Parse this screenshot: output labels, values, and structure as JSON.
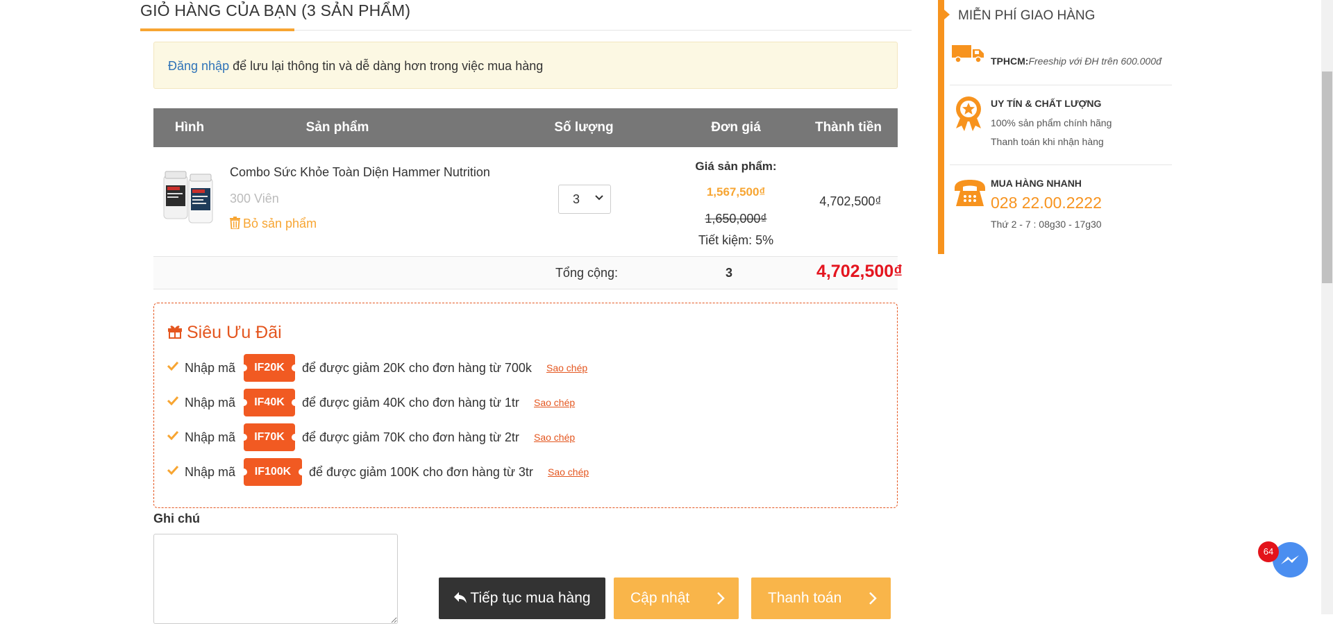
{
  "cart": {
    "title": "GIỎ HÀNG CỦA BẠN (3 SẢN PHẨM)",
    "notice_link": "Đăng nhập",
    "notice_text": " để lưu lại thông tin và dễ dàng hơn trong việc mua hàng",
    "columns": [
      "Hình",
      "Sản phẩm",
      "Số lượng",
      "Đơn giá",
      "Thành tiền"
    ],
    "item": {
      "name": "Combo Sức Khỏe Toàn Diện Hammer Nutrition",
      "variant": "300 Viên",
      "remove_label": "Bỏ sản phẩm",
      "quantity": "3",
      "price_label": "Giá sản phẩm:",
      "sale_price": "1,567,500₫",
      "old_price": "1,650,000₫",
      "saving": "Tiết kiệm: 5%",
      "line_total": "4,702,500₫"
    },
    "summary": {
      "label": "Tổng cộng:",
      "quantity": "3",
      "total": "4,702,500₫"
    }
  },
  "promo": {
    "title": "Siêu Ưu Đãi",
    "items": [
      {
        "prefix": "Nhập mã",
        "code": "IF20K",
        "desc": "để được giảm 20K cho đơn hàng từ 700k",
        "copy": "Sao chép"
      },
      {
        "prefix": "Nhập mã",
        "code": "IF40K",
        "desc": "để được giảm 40K cho đơn hàng từ 1tr",
        "copy": "Sao chép"
      },
      {
        "prefix": "Nhập mã",
        "code": "IF70K",
        "desc": "để được giảm 70K cho đơn hàng từ 2tr",
        "copy": "Sao chép"
      },
      {
        "prefix": "Nhập mã",
        "code": "IF100K",
        "desc": "để được giảm 100K cho đơn hàng từ 3tr",
        "copy": "Sao chép"
      }
    ]
  },
  "note": {
    "label": "Ghi chú",
    "value": ""
  },
  "buttons": {
    "continue": "Tiếp tục mua hàng",
    "update": "Cập nhật",
    "checkout": "Thanh toán"
  },
  "sidebar": {
    "heading": "MIỄN PHÍ GIAO HÀNG",
    "shipping_bold": "TPHCM:",
    "shipping_text": "Freeship với ĐH trên 600.000đ",
    "quality_title": "UY TÍN & CHẤT LƯỢNG",
    "quality_line1": "100% sản phẩm chính hãng",
    "quality_line2": "Thanh toán khi nhận hàng",
    "quick_title": "MUA HÀNG NHANH",
    "phone": "028 22.00.2222",
    "hours": "Thứ 2 - 7 : 08g30 - 17g30"
  },
  "messenger": {
    "badge": "64"
  },
  "colors": {
    "accent": "#f7931e",
    "promo": "#e4561f",
    "total": "#e4151f",
    "header_bg": "#777777"
  }
}
